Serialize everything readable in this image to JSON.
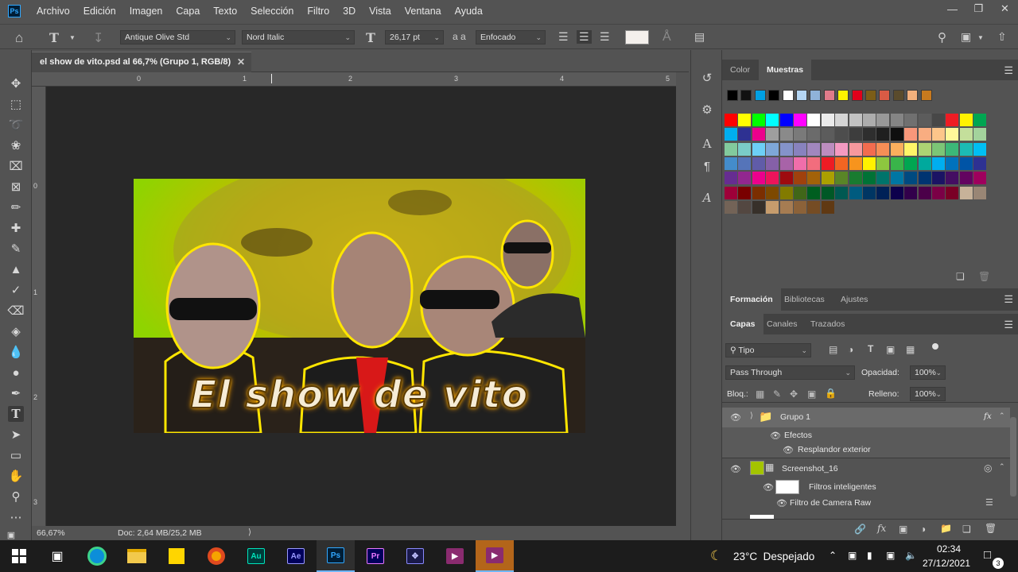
{
  "menu": {
    "items": [
      "Archivo",
      "Edición",
      "Imagen",
      "Capa",
      "Texto",
      "Selección",
      "Filtro",
      "3D",
      "Vista",
      "Ventana",
      "Ayuda"
    ],
    "app_logo": "Ps"
  },
  "options": {
    "font_family": "Antique Olive Std",
    "font_style": "Nord Italic",
    "font_size": "26,17 pt",
    "antialias_label": "a a",
    "antialias": "Enfocado",
    "text_color": "#f4f0ec"
  },
  "document": {
    "tab_title": "el show de vito.psd al 66,7% (Grupo 1, RGB/8)",
    "zoom": "66,67%",
    "doc_size": "Doc: 2,64 MB/25,2 MB",
    "ruler_top": [
      "0",
      "1",
      "2",
      "3",
      "4",
      "5"
    ],
    "ruler_left": [
      "0",
      "1",
      "2",
      "3"
    ]
  },
  "artwork": {
    "title_text": "El show de vito"
  },
  "color_panel": {
    "tabs": [
      "Color",
      "Muestras"
    ],
    "active_tab": "Muestras",
    "recent_swatches": [
      "#000000",
      "#111111",
      "#00a0e3",
      "#000000",
      "#ffffff",
      "#b5d6f3",
      "#8fb2d9",
      "#e07b8a",
      "#fff200",
      "#e0001b",
      "#7c5d18",
      "#d95b45",
      "#5a4b2c",
      "#f3b07c",
      "#c87a1e"
    ],
    "swatch_rows": [
      [
        "#ff0000",
        "#ffff00",
        "#00ff00",
        "#00ffff",
        "#0000ff",
        "#ff00ff",
        "#ffffff",
        "#ebebeb",
        "#d6d6d6",
        "#c2c2c2",
        "#adadad",
        "#999999",
        "#858585",
        "#707070",
        "#5c5c5c",
        "#474747",
        "#ed1c24",
        "#fff200",
        "#00a651"
      ],
      [
        "#00aeef",
        "#2e3192",
        "#ec008c",
        "#9e9e9e",
        "#8a8a8a",
        "#7a7a7a",
        "#6b6b6b",
        "#5c5c5c",
        "#4d4d4d",
        "#3d3d3d",
        "#2e2e2e",
        "#1f1f1f",
        "#0f0f0f",
        "#f7977a",
        "#f9ad81",
        "#fdc68a",
        "#fff79a",
        "#c4df9b",
        "#a3d39c"
      ],
      [
        "#82ca9d",
        "#7accc8",
        "#6dcff6",
        "#7ea7d8",
        "#8493ca",
        "#8882be",
        "#a187be",
        "#bc8dbf",
        "#f49ac2",
        "#f6989d",
        "#f26c4f",
        "#f68e56",
        "#fbaf5d",
        "#fff568",
        "#acd373",
        "#7cc576",
        "#3cb878",
        "#1cbbb4",
        "#00bff3"
      ],
      [
        "#448ccb",
        "#5574b9",
        "#605ca8",
        "#8560a8",
        "#a863a8",
        "#f06eaa",
        "#f26d7d",
        "#ed1c24",
        "#f26522",
        "#f7941d",
        "#fff200",
        "#8dc73f",
        "#39b54a",
        "#00a651",
        "#00a99d",
        "#00aeef",
        "#0072bc",
        "#0054a6",
        "#2e3192"
      ],
      [
        "#662d91",
        "#92278f",
        "#ec008c",
        "#ed145b",
        "#9e0b0f",
        "#a0410d",
        "#a36209",
        "#aba000",
        "#598527",
        "#197b30",
        "#007236",
        "#00746b",
        "#0076a3",
        "#004a80",
        "#003471",
        "#1b1464",
        "#440e62",
        "#630460",
        "#9e005d"
      ],
      [
        "#9e0039",
        "#790000",
        "#7b2e00",
        "#7d4900",
        "#827b00",
        "#406618",
        "#005e20",
        "#005826",
        "#005952",
        "#005b7f",
        "#003663",
        "#002157",
        "#0d004c",
        "#32004b",
        "#4b0049",
        "#7b0046",
        "#7a0026",
        "#c7b299",
        "#998675"
      ],
      [
        "#736357",
        "#534741",
        "#37302a",
        "#c69c6d",
        "#a67c52",
        "#8c6239",
        "#754c24",
        "#603913"
      ]
    ]
  },
  "formacion_panel": {
    "tabs": [
      "Formación",
      "Bibliotecas",
      "Ajustes"
    ],
    "active_tab": "Formación"
  },
  "layers_panel": {
    "tabs": [
      "Capas",
      "Canales",
      "Trazados"
    ],
    "active_tab": "Capas",
    "filter_kind": "Tipo",
    "blend_mode": "Pass Through",
    "opacity_label": "Opacidad:",
    "opacity": "100%",
    "lock_label": "Bloq.:",
    "fill_label": "Relleno:",
    "fill": "100%",
    "layers": [
      {
        "name": "Grupo 1",
        "type": "group",
        "fx": "fx"
      },
      {
        "name": "Efectos",
        "type": "effects"
      },
      {
        "name": "Resplandor exterior",
        "type": "effect"
      },
      {
        "name": "Screenshot_16",
        "type": "smart-object"
      },
      {
        "name": "Filtros inteligentes",
        "type": "smart-filters"
      },
      {
        "name": "Filtro de Camera Raw",
        "type": "filter"
      }
    ]
  },
  "taskbar": {
    "apps": [
      "Windows",
      "Task View",
      "Edge",
      "File Explorer",
      "Sticky Notes",
      "Chrome Canary",
      "Au",
      "Ae",
      "Ps",
      "Pr",
      "Video Editor",
      "Meet",
      "Meet 2"
    ],
    "weather": "23°C  Despejado",
    "time": "02:34",
    "date": "27/12/2021",
    "notification_count": "3"
  }
}
